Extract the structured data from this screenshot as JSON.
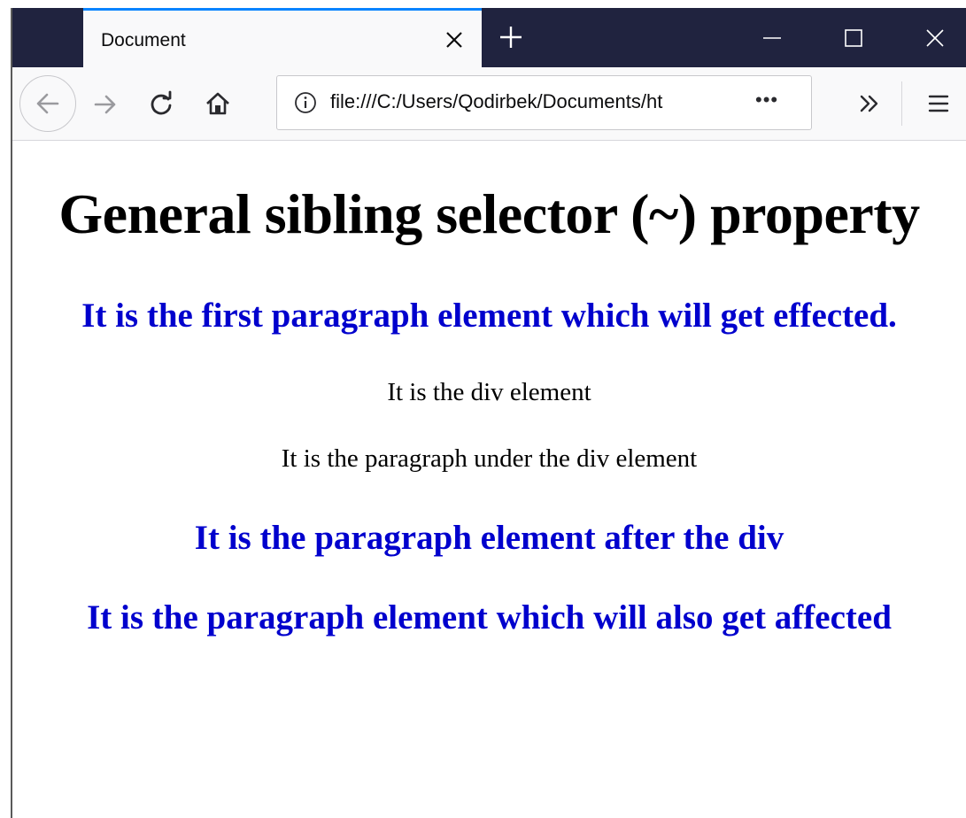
{
  "tab": {
    "title": "Document"
  },
  "urlbar": {
    "url": "file:///C:/Users/Qodirbek/Documents/ht",
    "page_actions": "•••"
  },
  "page": {
    "heading": "General sibling selector (~) property",
    "first_paragraph": "It is the first paragraph element which will get effected.",
    "div_text": "It is the div element",
    "div_paragraph": "It is the paragraph under the div element",
    "after_div_paragraph": "It is the paragraph element after the div",
    "also_affected_paragraph": "It is the paragraph element which will also get affected"
  },
  "colors": {
    "tabstrip": "#20233f",
    "tab_accent": "#0a84ff",
    "affected_text": "#0000cd",
    "normal_text": "#000000"
  },
  "icons": [
    "tab-close-icon",
    "new-tab-icon",
    "minimize-icon",
    "maximize-icon",
    "window-close-icon",
    "back-arrow-icon",
    "forward-arrow-icon",
    "reload-icon",
    "home-icon",
    "info-icon",
    "overflow-chevron-icon",
    "hamburger-menu-icon"
  ]
}
